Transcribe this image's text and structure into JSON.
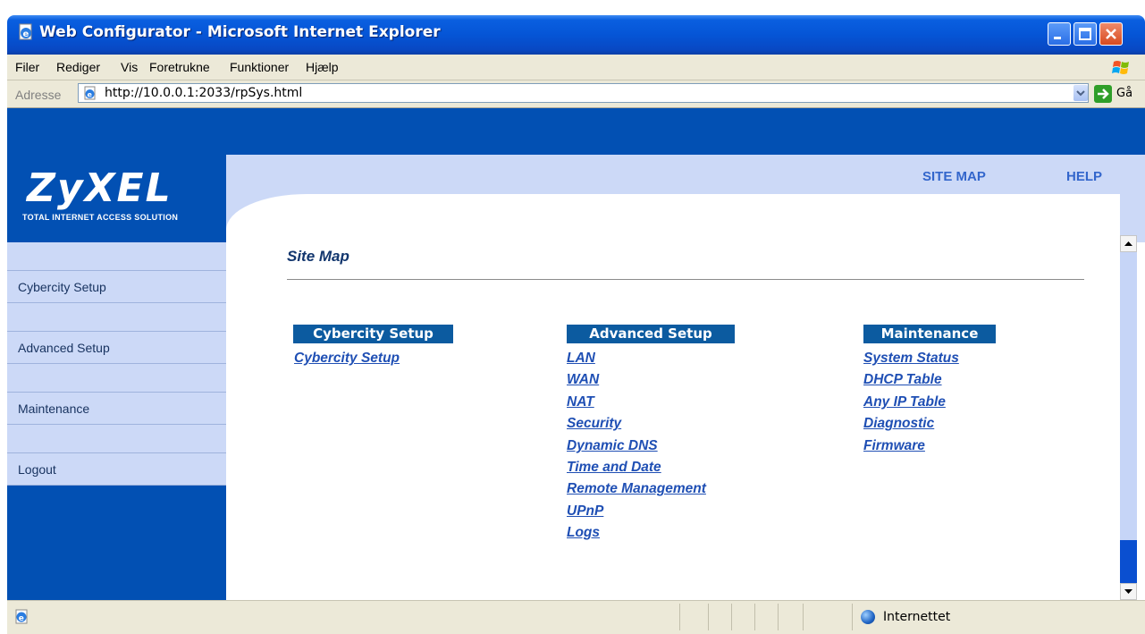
{
  "browser": {
    "title": "Web Configurator - Microsoft Internet Explorer",
    "menu": [
      "Filer",
      "Rediger",
      "Vis",
      "Foretrukne",
      "Funktioner",
      "Hjælp"
    ],
    "address_label": "Adresse",
    "url": "http://10.0.0.1:2033/rpSys.html",
    "go_label": "Gå",
    "status_zone": "Internettet"
  },
  "brand": {
    "logo": "ZyXEL",
    "tagline": "TOTAL INTERNET ACCESS SOLUTION"
  },
  "header_links": {
    "site_map": "SITE MAP",
    "help": "HELP"
  },
  "sidebar": {
    "items": [
      {
        "label": "Cybercity Setup"
      },
      {
        "label": "Advanced Setup"
      },
      {
        "label": "Maintenance"
      },
      {
        "label": "Logout"
      }
    ]
  },
  "main": {
    "title": "Site Map",
    "columns": [
      {
        "heading": "Cybercity Setup",
        "links": [
          "Cybercity Setup"
        ]
      },
      {
        "heading": "Advanced Setup",
        "links": [
          "LAN",
          "WAN",
          "NAT",
          "Security",
          "Dynamic DNS",
          "Time and Date",
          "Remote Management",
          "UPnP",
          "Logs"
        ]
      },
      {
        "heading": "Maintenance",
        "links": [
          "System Status",
          "DHCP Table",
          "Any IP Table",
          "Diagnostic",
          "Firmware"
        ]
      }
    ]
  },
  "colors": {
    "brand_blue": "#0250b3",
    "light_blue": "#ccd9f7",
    "heading_blue": "#0c5ba0",
    "link_blue": "#1f4fb4"
  },
  "icons": {
    "window": "ie-page-icon",
    "go": "go-arrow-icon",
    "zone": "globe-icon"
  }
}
